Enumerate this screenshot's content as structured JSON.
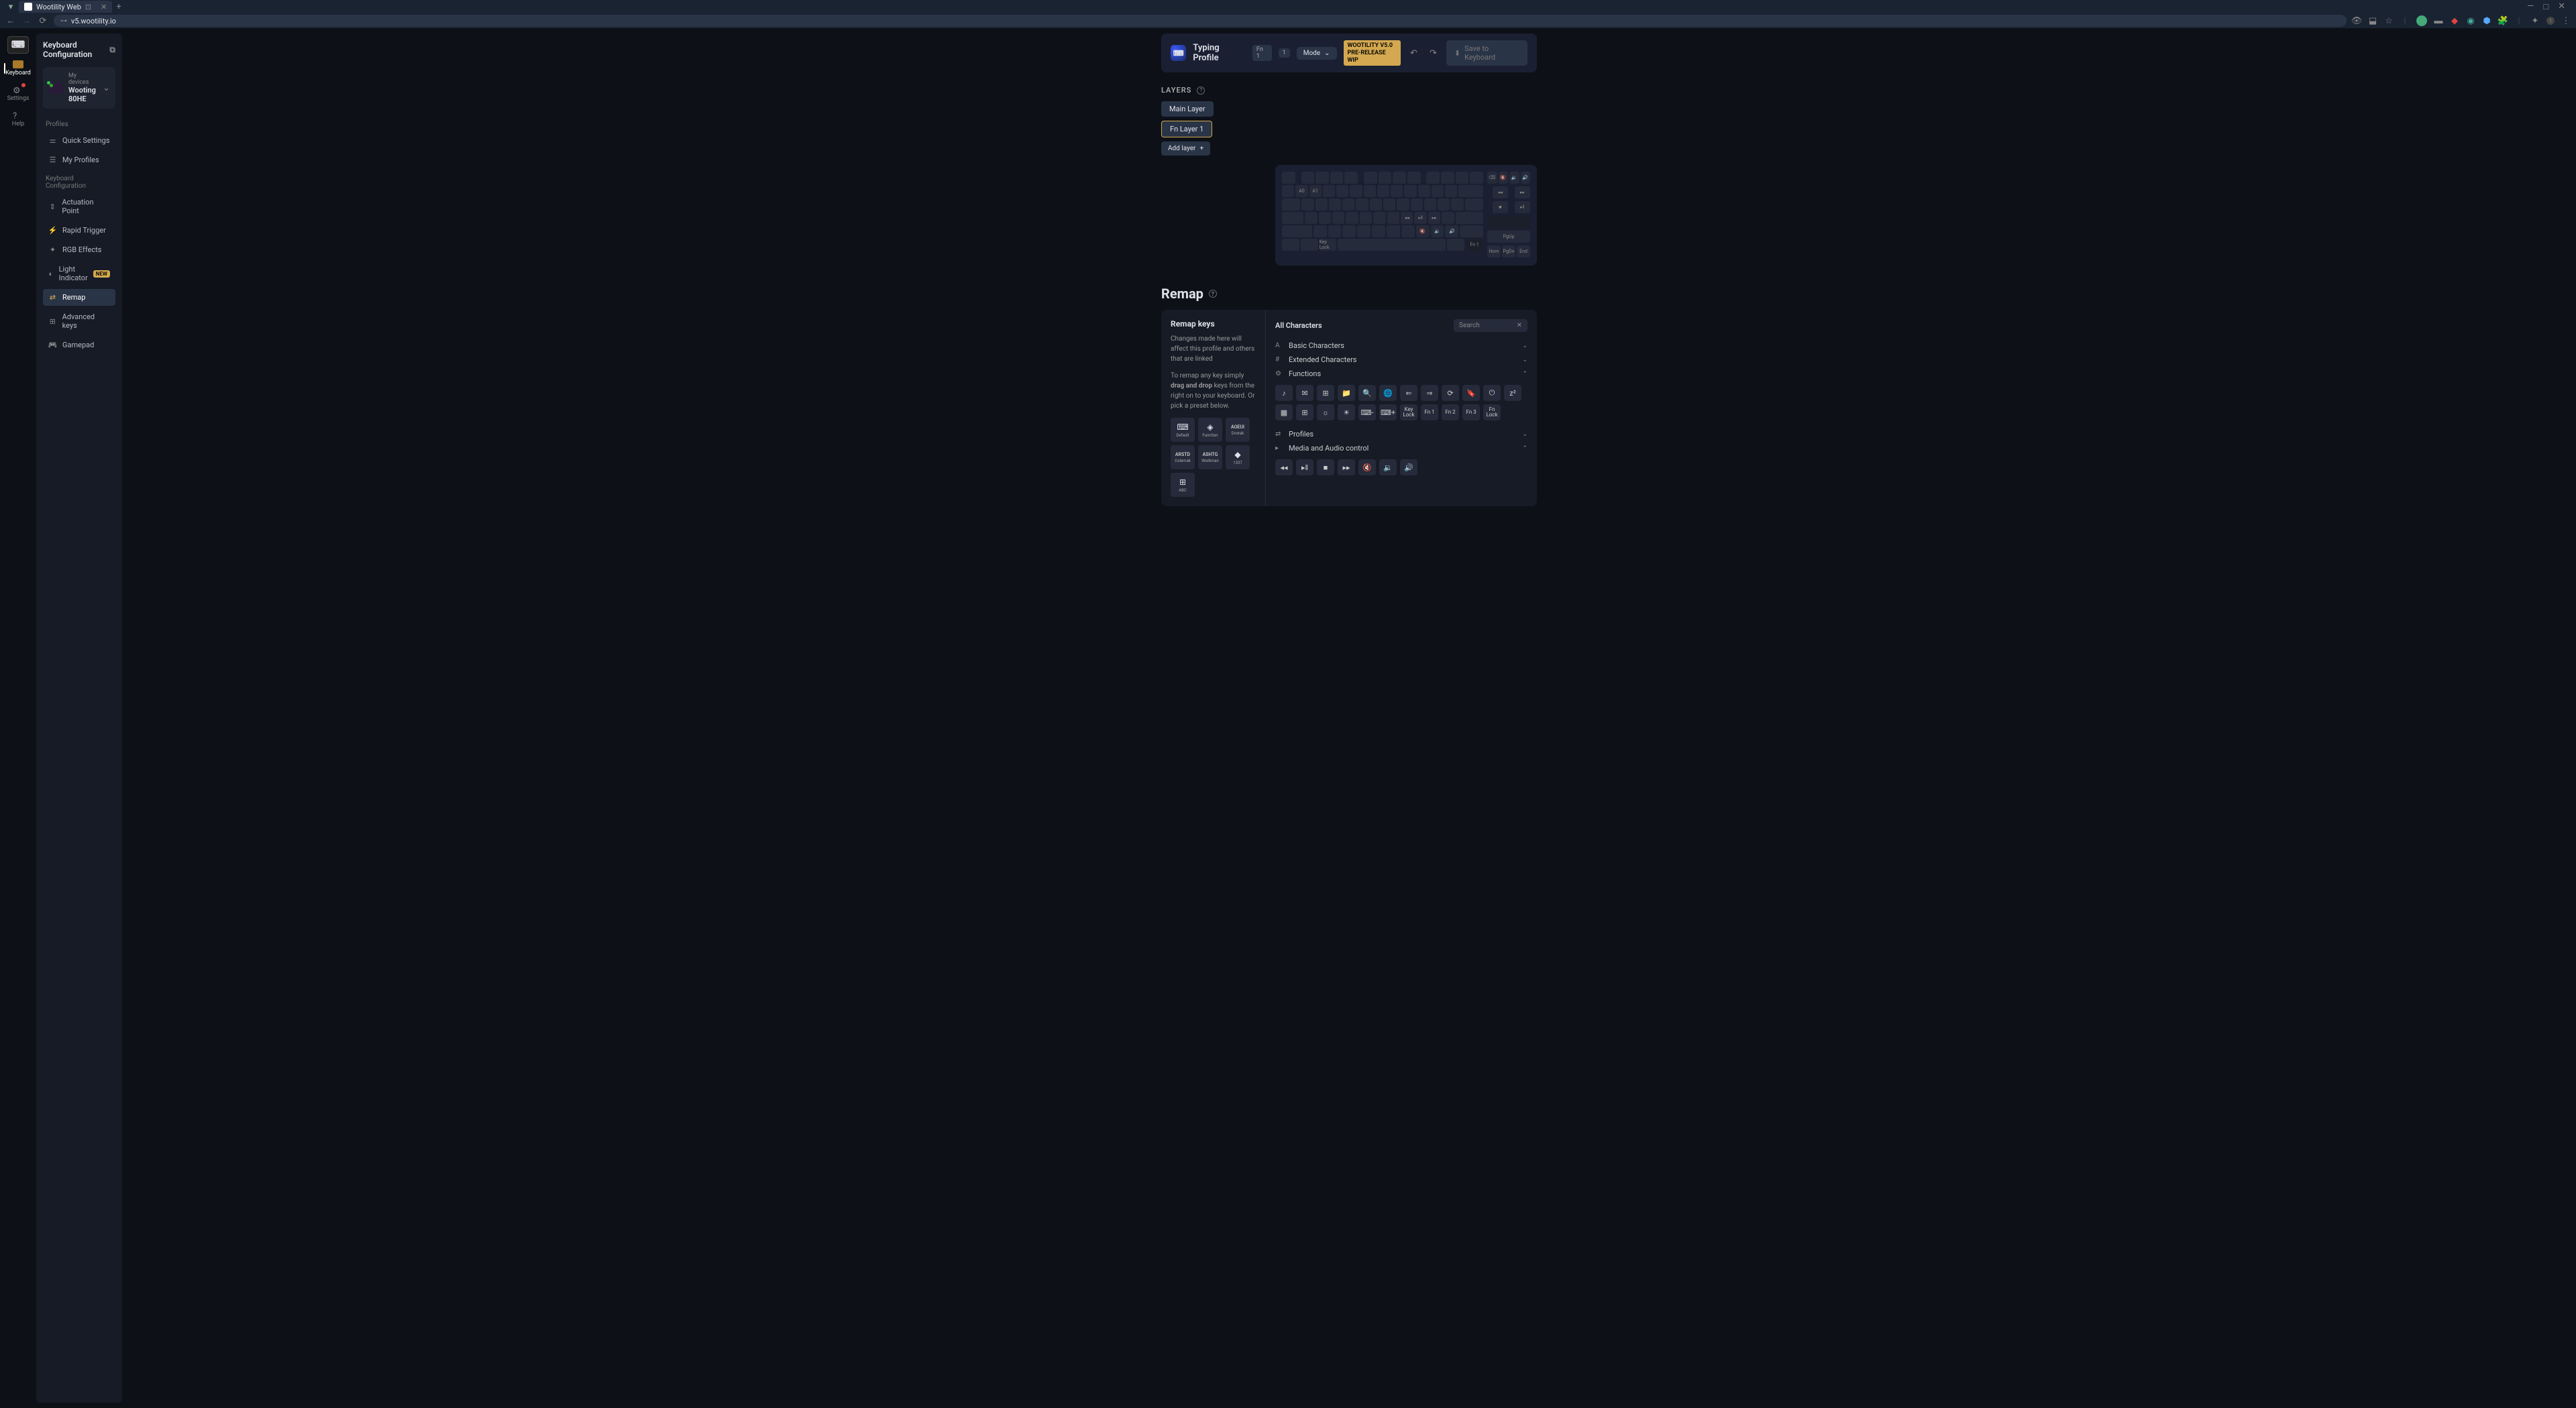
{
  "browser": {
    "tab_title": "Wootility Web",
    "url": "v5.wootility.io"
  },
  "rail": {
    "keyboard": "Keyboard",
    "settings": "Settings",
    "help": "Help"
  },
  "sidebar": {
    "title": "Keyboard Configuration",
    "device": {
      "sub": "My devices",
      "name": "Wooting 80HE"
    },
    "profiles_section": "Profiles",
    "quick_settings": "Quick Settings",
    "my_profiles": "My Profiles",
    "config_section": "Keyboard Configuration",
    "actuation": "Actuation Point",
    "rapid": "Rapid Trigger",
    "rgb": "RGB Effects",
    "light": "Light Indicator",
    "new_badge": "NEW",
    "remap": "Remap",
    "advanced": "Advanced keys",
    "gamepad": "Gamepad"
  },
  "profile": {
    "name": "Typing Profile",
    "pill_fn": "Fn",
    "pill_1": "1",
    "pill_2": "1",
    "mode": "Mode",
    "version_l1": "WOOTILITY V5.0",
    "version_l2": "PRE-RELEASE WIP",
    "save": "Save to Keyboard"
  },
  "layers": {
    "label": "LAYERS",
    "main": "Main Layer",
    "fn1": "Fn Layer 1",
    "add": "Add layer"
  },
  "keys": {
    "a0": "A0",
    "a1": "A1",
    "fn1": "Fn 1",
    "hom": "Hom",
    "pgdn": "PgDn",
    "end": "End",
    "pgup": "PgUp",
    "keylock": "Key Lock"
  },
  "remap": {
    "title": "Remap",
    "heading": "Remap keys",
    "desc1": "Changes made here will affect this profile and others that are linked",
    "desc2_a": "To remap any key simply ",
    "desc2_b": "drag and drop",
    "desc2_c": " keys from the right on to your keyboard. Or pick a preset below.",
    "presets": {
      "default": "Default",
      "function": "Function",
      "aoeui": "AOEUI",
      "dvorak": "Dvorak",
      "arstd": "ARSTD",
      "colemak": "Colemak",
      "ashtg": "ASHTG",
      "workman": "Workman",
      "l33t": "1337",
      "abc": "ABC"
    },
    "all_chars": "All Characters",
    "search": "Search",
    "basic": "Basic Characters",
    "extended": "Extended Characters",
    "functions": "Functions",
    "profiles": "Profiles",
    "media": "Media and Audio control",
    "fn_keys": {
      "keylock": "Key Lock",
      "fn1": "Fn 1",
      "fn2": "Fn 2",
      "fn3": "Fn 3",
      "fnlock": "Fn Lock"
    }
  }
}
